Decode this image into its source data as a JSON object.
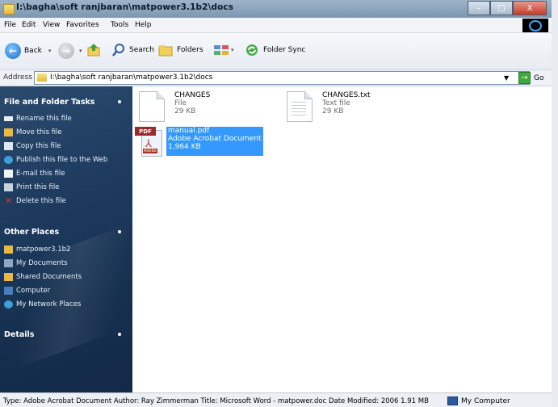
{
  "window": {
    "title": "I:\\bagha\\soft ranjbaran\\matpower3.1b2\\docs",
    "min": "–",
    "max": "□",
    "close": "X"
  },
  "menu": [
    "File",
    "Edit",
    "View",
    "Favorites",
    "Tools",
    "Help"
  ],
  "toolbar": {
    "back": "Back",
    "search": "Search",
    "folders": "Folders",
    "folder_sync": "Folder Sync"
  },
  "address": {
    "label": "Address",
    "path": "I:\\bagha\\soft ranjbaran\\matpower3.1b2\\docs",
    "go": "Go"
  },
  "sidebar": {
    "tasks_title": "File and Folder Tasks",
    "tasks": [
      "Rename this file",
      "Move this file",
      "Copy this file",
      "Publish this file to the Web",
      "E-mail this file",
      "Print this file",
      "Delete this file"
    ],
    "places_title": "Other Places",
    "places": [
      "matpower3.1b2",
      "My Documents",
      "Shared Documents",
      "Computer",
      "My Network Places"
    ],
    "details_title": "Details"
  },
  "files": [
    {
      "name": "CHANGES",
      "type": "File",
      "size": "29 KB"
    },
    {
      "name": "CHANGES.txt",
      "type": "Text file",
      "size": "29 KB"
    },
    {
      "name": "manual.pdf",
      "type": "Adobe Acrobat Document",
      "size": "1,964 KB",
      "pdf_tag": "PDF",
      "pdf_brand": "Adobe"
    }
  ],
  "status": {
    "text": "Type: Adobe Acrobat Document Author: Ray Zimmerman Title: Microsoft Word - matpower.doc Date Modified: 2006  1.91 MB",
    "zone": "My Computer"
  },
  "colors": {
    "sidebar": "#1d3a5e",
    "selection": "#3399ff"
  }
}
